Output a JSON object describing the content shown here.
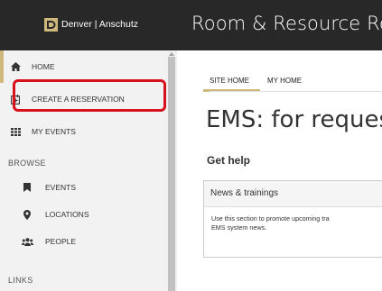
{
  "header": {
    "logo_text": "Denver | Anschutz",
    "app_title": "Room & Resource Re"
  },
  "sidebar": {
    "items": [
      {
        "label": "HOME",
        "icon": "home-icon"
      },
      {
        "label": "CREATE A RESERVATION",
        "icon": "calendar-plus-icon"
      },
      {
        "label": "MY EVENTS",
        "icon": "grid-icon"
      }
    ],
    "browse_label": "BROWSE",
    "browse_items": [
      {
        "label": "EVENTS",
        "icon": "bookmark-icon"
      },
      {
        "label": "LOCATIONS",
        "icon": "map-marker-icon"
      },
      {
        "label": "PEOPLE",
        "icon": "people-icon"
      }
    ],
    "links_label": "LINKS"
  },
  "main": {
    "tabs": [
      {
        "label": "SITE HOME",
        "active": true
      },
      {
        "label": "MY HOME",
        "active": false
      }
    ],
    "page_title": "EMS: for reques",
    "help_title": "Get help",
    "panel": {
      "title": "News & trainings",
      "body": "Use this section to promote upcoming tra\nEMS system news."
    }
  },
  "colors": {
    "header_bg": "#282828",
    "accent_gold": "#cfb87c",
    "highlight_red": "#d9101e",
    "sidebar_bg": "#f2f2f2"
  }
}
